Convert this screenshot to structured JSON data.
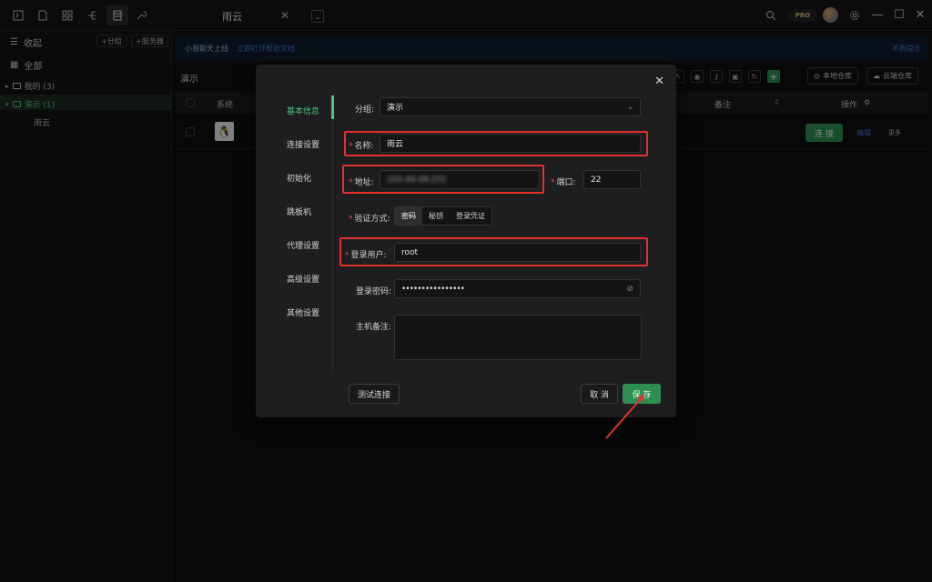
{
  "colors": {
    "accent": "#4cc37a",
    "primary_button": "#2f8f52",
    "highlight": "#e0312d",
    "link": "#3f7fd8"
  },
  "topbar": {
    "tab_title": "雨云",
    "tab_close": "✕",
    "pro_label": "PRO",
    "icons": [
      "terminal-icon",
      "file-icon",
      "apps-icon",
      "tree-icon",
      "server-list-icon",
      "wrench-icon",
      "search-icon",
      "settings-icon",
      "minimize-icon",
      "maximize-icon",
      "close-icon"
    ]
  },
  "sidebar": {
    "collapse_label": "收起",
    "add_group_label": "+分组",
    "add_server_label": "+服务器",
    "all_label": "全部",
    "groups": [
      {
        "label": "我的 (3)",
        "expanded": false
      },
      {
        "label": "演示 (1)",
        "expanded": true,
        "children": [
          "雨云"
        ]
      }
    ]
  },
  "notice": {
    "text": "小易聊天上线",
    "link": "立即打开帮助文档",
    "dismiss": "不再提示"
  },
  "main": {
    "breadcrumb": "演示",
    "local_store": "本地仓库",
    "cloud_store": "云端仓库",
    "table": {
      "headers": {
        "system": "系统",
        "remark": "备注",
        "action": "操作"
      },
      "rows": [
        {
          "os": "linux",
          "connect": "连 接",
          "edit": "编辑",
          "more": "更多"
        }
      ]
    }
  },
  "modal": {
    "nav": [
      "基本信息",
      "连接设置",
      "初始化",
      "跳板机",
      "代理设置",
      "高级设置",
      "其他设置"
    ],
    "fields": {
      "group_label": "分组:",
      "group_value": "演示",
      "name_label": "名称:",
      "name_value": "雨云",
      "address_label": "地址:",
      "address_value": "103.49.49.231",
      "port_label": "端口:",
      "port_value": "22",
      "auth_label": "验证方式:",
      "auth_options": [
        "密码",
        "秘钥",
        "登录凭证"
      ],
      "auth_selected": "密码",
      "user_label": "登录用户:",
      "user_value": "root",
      "password_label": "登录密码:",
      "password_value": "••••••••••••••••",
      "remark_label": "主机备注:"
    },
    "buttons": {
      "test": "测试连接",
      "cancel": "取 消",
      "save": "保 存"
    }
  }
}
